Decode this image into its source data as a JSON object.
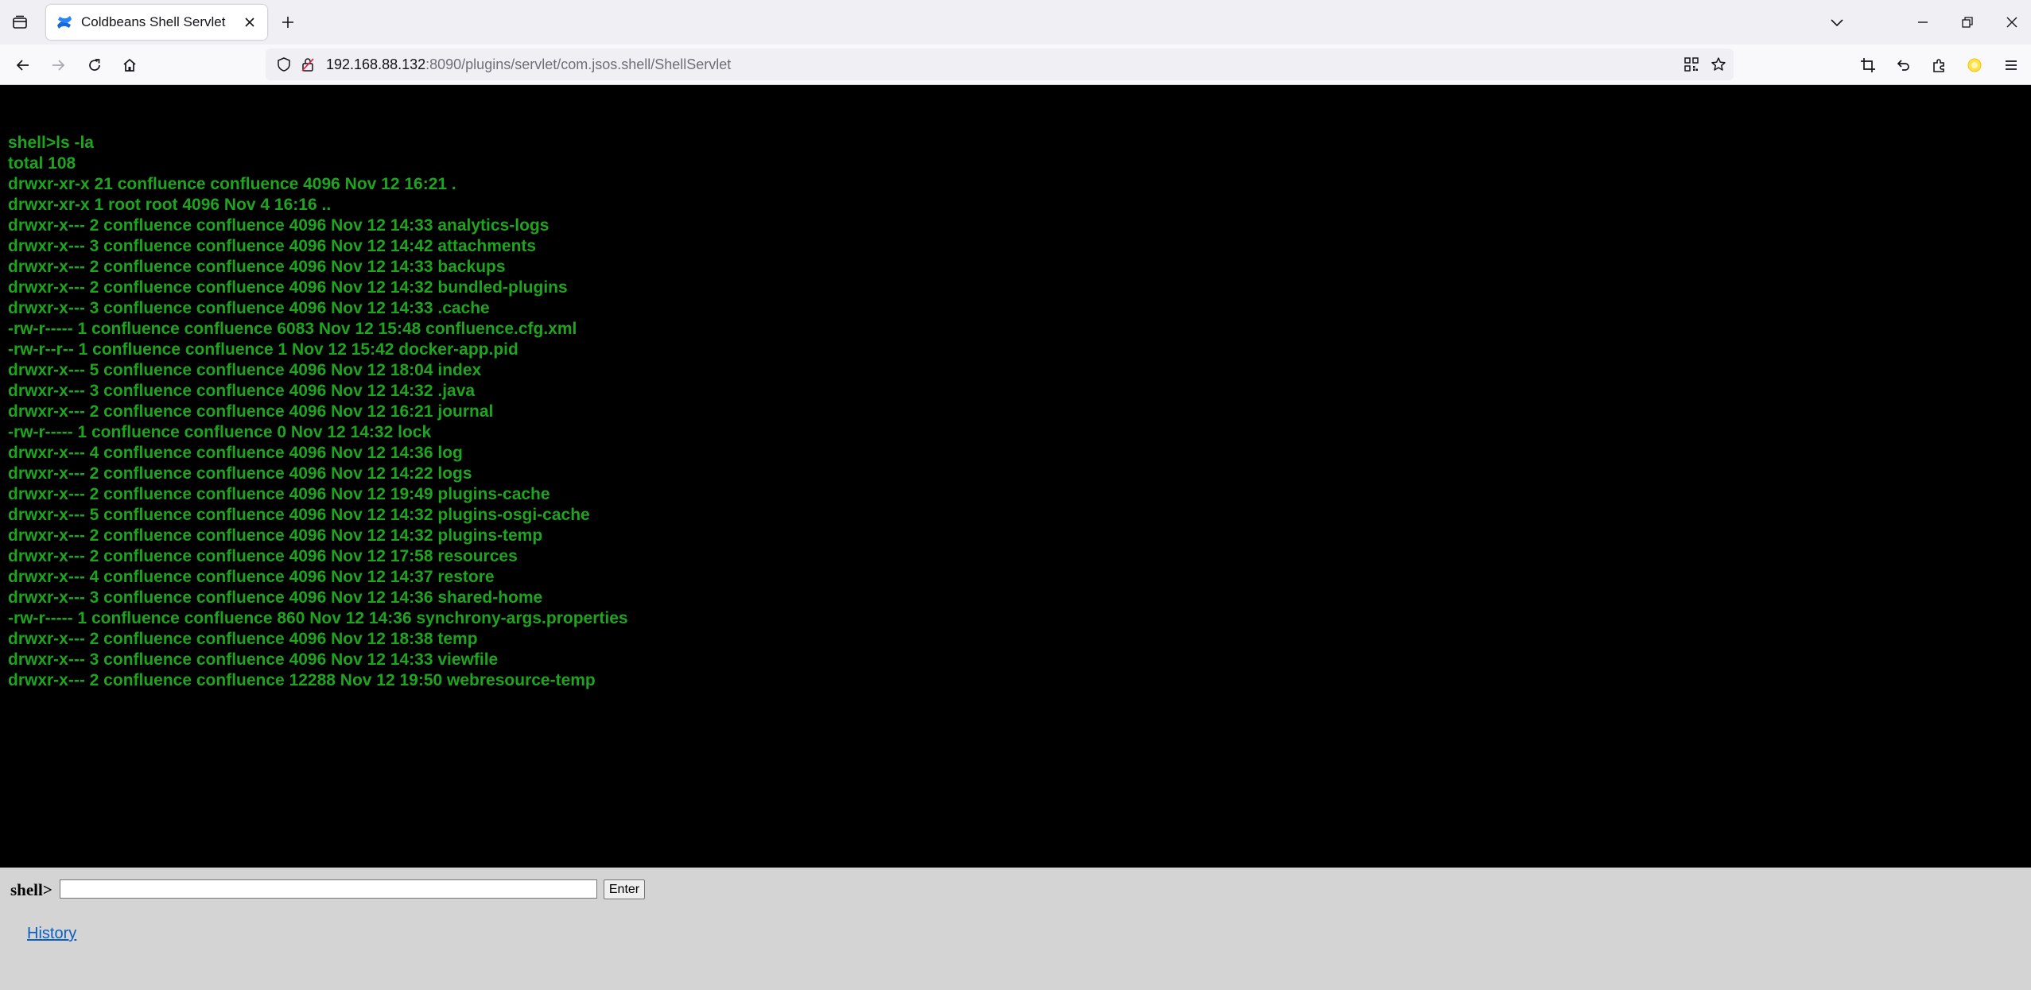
{
  "browser": {
    "tab": {
      "title": "Coldbeans Shell Servlet"
    },
    "url": {
      "host": "192.168.88.132",
      "rest": ":8090/plugins/servlet/com.jsos.shell/ShellServlet"
    },
    "icons": {
      "tab_list": "tab-list-icon",
      "favicon": "confluence-favicon",
      "close": "close-icon",
      "new_tab": "plus-icon",
      "back": "back-arrow-icon",
      "forward": "forward-arrow-icon",
      "reload": "reload-icon",
      "home": "home-icon",
      "shield": "shield-icon",
      "insecure": "insecure-lock-icon",
      "qr": "qr-code-icon",
      "bookmark": "star-icon",
      "screenshot": "crop-icon",
      "undo": "undo-icon",
      "extensions": "puzzle-icon",
      "account": "account-icon",
      "menu": "hamburger-menu-icon"
    },
    "accent_color": "#1ea41e"
  },
  "terminal": {
    "lines": [
      "shell>ls -la",
      "total 108",
      "drwxr-xr-x 21 confluence confluence 4096 Nov 12 16:21 .",
      "drwxr-xr-x 1 root root 4096 Nov 4 16:16 ..",
      "drwxr-x--- 2 confluence confluence 4096 Nov 12 14:33 analytics-logs",
      "drwxr-x--- 3 confluence confluence 4096 Nov 12 14:42 attachments",
      "drwxr-x--- 2 confluence confluence 4096 Nov 12 14:33 backups",
      "drwxr-x--- 2 confluence confluence 4096 Nov 12 14:32 bundled-plugins",
      "drwxr-x--- 3 confluence confluence 4096 Nov 12 14:33 .cache",
      "-rw-r----- 1 confluence confluence 6083 Nov 12 15:48 confluence.cfg.xml",
      "-rw-r--r-- 1 confluence confluence 1 Nov 12 15:42 docker-app.pid",
      "drwxr-x--- 5 confluence confluence 4096 Nov 12 18:04 index",
      "drwxr-x--- 3 confluence confluence 4096 Nov 12 14:32 .java",
      "drwxr-x--- 2 confluence confluence 4096 Nov 12 16:21 journal",
      "-rw-r----- 1 confluence confluence 0 Nov 12 14:32 lock",
      "drwxr-x--- 4 confluence confluence 4096 Nov 12 14:36 log",
      "drwxr-x--- 2 confluence confluence 4096 Nov 12 14:22 logs",
      "drwxr-x--- 2 confluence confluence 4096 Nov 12 19:49 plugins-cache",
      "drwxr-x--- 5 confluence confluence 4096 Nov 12 14:32 plugins-osgi-cache",
      "drwxr-x--- 2 confluence confluence 4096 Nov 12 14:32 plugins-temp",
      "drwxr-x--- 2 confluence confluence 4096 Nov 12 17:58 resources",
      "drwxr-x--- 4 confluence confluence 4096 Nov 12 14:37 restore",
      "drwxr-x--- 3 confluence confluence 4096 Nov 12 14:36 shared-home",
      "-rw-r----- 1 confluence confluence 860 Nov 12 14:36 synchrony-args.properties",
      "drwxr-x--- 2 confluence confluence 4096 Nov 12 18:38 temp",
      "drwxr-x--- 3 confluence confluence 4096 Nov 12 14:33 viewfile",
      "drwxr-x--- 2 confluence confluence 12288 Nov 12 19:50 webresource-temp"
    ]
  },
  "form": {
    "prompt": "shell>",
    "input_value": "",
    "enter_label": "Enter",
    "history_label": "History"
  }
}
